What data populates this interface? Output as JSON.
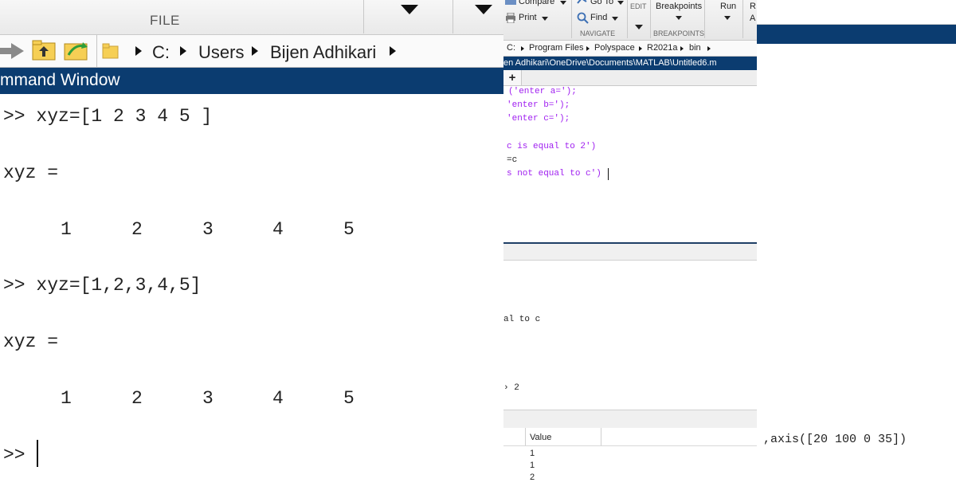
{
  "left_panel": {
    "file_label": "FILE",
    "address": {
      "drive": "C:",
      "folder1": "Users",
      "folder2": "Bijen Adhikari"
    },
    "window_title": "mmand Window",
    "lines": {
      "cmd1": ">> xyz=[1 2 3 4 5 ]",
      "out1_label": "xyz =",
      "cmd2": ">> xyz=[1,2,3,4,5]",
      "out2_label": "xyz =",
      "prompt": ">>"
    },
    "values1": [
      "1",
      "2",
      "3",
      "4",
      "5"
    ],
    "values2": [
      "1",
      "2",
      "3",
      "4",
      "5"
    ]
  },
  "middle_panel": {
    "ribbon": {
      "compare": "Compare",
      "print": "Print",
      "goto": "Go To",
      "find": "Find",
      "navigate": "NAVIGATE",
      "edit": "EDIT",
      "breakpoints": "Breakpoints",
      "breakpoints_group": "BREAKPOINTS",
      "run": "Run",
      "r_letter": "R",
      "a_letter": "A"
    },
    "address": {
      "drive": "C:",
      "p1": "Program Files",
      "p2": "Polyspace",
      "p3": "R2021a",
      "p4": "bin"
    },
    "file_path": "en Adhikari\\OneDrive\\Documents\\MATLAB\\Untitled6.m",
    "new_tab": "+",
    "editor_lines": {
      "l1": "('enter a=');",
      "l2": "'enter b=');",
      "l3": "'enter c=');",
      "l5": "c is equal to 2')",
      "l6": "=c",
      "l7": "s not equal to c')"
    },
    "output_lines": {
      "o1": "al to c",
      "o2": "› 2"
    },
    "workspace": {
      "value_header": "Value",
      "values": [
        "1",
        "1",
        "2"
      ]
    }
  },
  "right_panel": {
    "code_fragment": ",axis([20 100 0 35])"
  }
}
